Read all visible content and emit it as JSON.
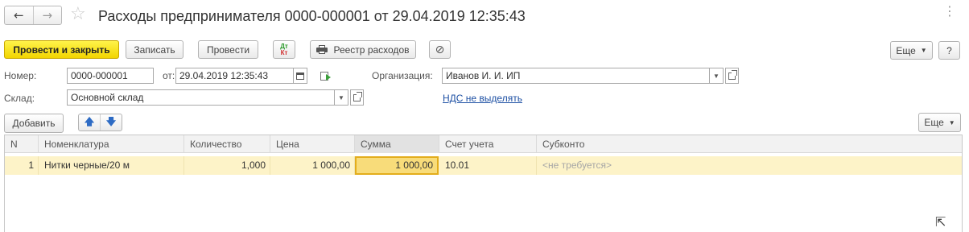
{
  "window": {
    "nav_back": "←",
    "nav_forward": "→",
    "favorite_star": "☆",
    "title": "Расходы предпринимателя 0000-000001 от 29.04.2019 12:35:43",
    "more": "⋮"
  },
  "toolbar": {
    "post_and_close": "Провести и закрыть",
    "save": "Записать",
    "post": "Провести",
    "dt_label": "Дт",
    "kt_label": "Кт",
    "expense_register": "Реестр расходов",
    "attach_icon": "paperclip-icon",
    "more": "Еще",
    "help": "?"
  },
  "form": {
    "number_label": "Номер:",
    "number_value": "0000-000001",
    "date_label": "от:",
    "date_value": "29.04.2019 12:35:43",
    "organization_label": "Организация:",
    "organization_value": "Иванов И. И. ИП",
    "warehouse_label": "Склад:",
    "warehouse_value": "Основной склад",
    "vat_link": "НДС не выделять"
  },
  "table_toolbar": {
    "add": "Добавить",
    "move_up": "🡅",
    "move_down": "🡇",
    "more": "Еще"
  },
  "table": {
    "columns": [
      "N",
      "Номенклатура",
      "Количество",
      "Цена",
      "Сумма",
      "Счет учета",
      "Субконто"
    ],
    "rows": [
      {
        "n": "1",
        "item": "Нитки черные/20 м",
        "quantity": "1,000",
        "price": "1 000,00",
        "sum": "1 000,00",
        "account": "10.01",
        "subconto": "<не требуется>"
      }
    ]
  },
  "colors": {
    "primary_button": "#f2d500",
    "selected_row": "#fdf3c8",
    "current_cell": "#f8dc7a",
    "link": "#1c4fa3"
  }
}
